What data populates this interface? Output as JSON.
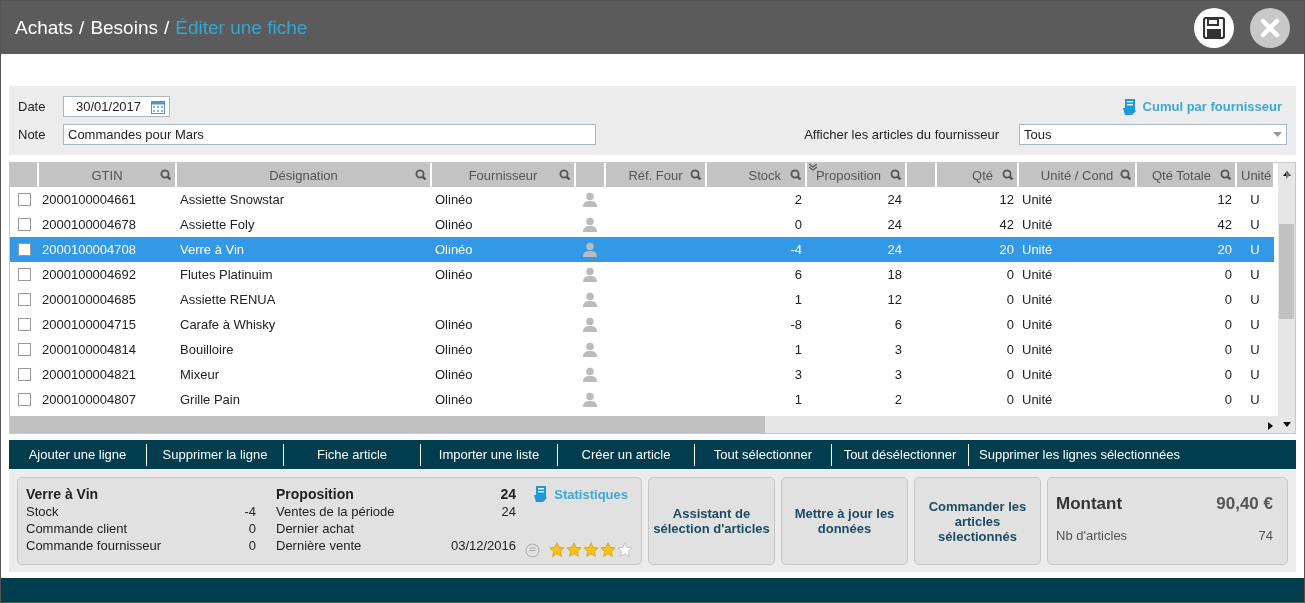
{
  "header": {
    "breadcrumb": [
      "Achats",
      "Besoins"
    ],
    "separator": "/",
    "current": "Éditer une fiche"
  },
  "form": {
    "date_label": "Date",
    "date": "30/01/2017",
    "note_label": "Note",
    "note": "Commandes pour Mars",
    "cumul_link": "Cumul par fournisseur",
    "supplier_filter_label": "Afficher les articles du fournisseur",
    "supplier_filter": "Tous"
  },
  "table": {
    "columns": [
      {
        "kind": "check"
      },
      {
        "kind": "text",
        "label": "GTIN",
        "search": true
      },
      {
        "kind": "text",
        "label": "Désignation",
        "search": true
      },
      {
        "kind": "text",
        "label": "Fournisseur",
        "search": true
      },
      {
        "kind": "icon"
      },
      {
        "kind": "text",
        "label": "Réf. Four",
        "search": true
      },
      {
        "kind": "num",
        "label": "Stock",
        "search": true
      },
      {
        "kind": "num",
        "label": "Proposition",
        "search": true,
        "sorted": true
      },
      {
        "kind": "blank"
      },
      {
        "kind": "num",
        "label": "Qté",
        "search": true
      },
      {
        "kind": "text",
        "label": "Unité / Cond",
        "search": true
      },
      {
        "kind": "num",
        "label": "Qté Totale",
        "search": true
      },
      {
        "kind": "center",
        "label": "Unité"
      }
    ],
    "rows": [
      {
        "selected": false,
        "checked": false,
        "cells": [
          "",
          "2000100004661",
          "Assiette Snowstar",
          "Olinéo",
          "",
          "",
          "2",
          "24",
          "",
          "12",
          "Unité",
          "12",
          "U"
        ]
      },
      {
        "selected": false,
        "checked": false,
        "cells": [
          "",
          "2000100004678",
          "Assiette Foly",
          "Olinéo",
          "",
          "",
          "0",
          "24",
          "",
          "42",
          "Unité",
          "42",
          "U"
        ]
      },
      {
        "selected": true,
        "checked": false,
        "cells": [
          "",
          "2000100004708",
          "Verre à Vin",
          "Olinéo",
          "",
          "",
          "-4",
          "24",
          "",
          "20",
          "Unité",
          "20",
          "U"
        ]
      },
      {
        "selected": false,
        "checked": false,
        "cells": [
          "",
          "2000100004692",
          "Flutes Platinuim",
          "Olinéo",
          "",
          "",
          "6",
          "18",
          "",
          "0",
          "Unité",
          "0",
          "U"
        ]
      },
      {
        "selected": false,
        "checked": false,
        "cells": [
          "",
          "2000100004685",
          "Assiette RENUA",
          "",
          "",
          "",
          "1",
          "12",
          "",
          "0",
          "Unité",
          "0",
          "U"
        ]
      },
      {
        "selected": false,
        "checked": false,
        "cells": [
          "",
          "2000100004715",
          "Carafe à Whisky",
          "Olinéo",
          "",
          "",
          "-8",
          "6",
          "",
          "0",
          "Unité",
          "0",
          "U"
        ]
      },
      {
        "selected": false,
        "checked": false,
        "cells": [
          "",
          "2000100004814",
          "Bouilloire",
          "Olinéo",
          "",
          "",
          "1",
          "3",
          "",
          "0",
          "Unité",
          "0",
          "U"
        ]
      },
      {
        "selected": false,
        "checked": false,
        "cells": [
          "",
          "2000100004821",
          "Mixeur",
          "Olinéo",
          "",
          "",
          "3",
          "3",
          "",
          "0",
          "Unité",
          "0",
          "U"
        ]
      },
      {
        "selected": false,
        "checked": false,
        "cells": [
          "",
          "2000100004807",
          "Grille Pain",
          "Olinéo",
          "",
          "",
          "1",
          "2",
          "",
          "0",
          "Unité",
          "0",
          "U"
        ]
      }
    ]
  },
  "toolbar": [
    "Ajouter une ligne",
    "Supprimer la ligne",
    "Fiche article",
    "Importer une liste",
    "Créer un article",
    "Tout sélectionner",
    "Tout désélectionner",
    "Supprimer les lignes sélectionnées"
  ],
  "details": {
    "title": "Verre à Vin",
    "left": [
      {
        "label": "Stock",
        "value": "-4"
      },
      {
        "label": "Commande client",
        "value": "0"
      },
      {
        "label": "Commande fournisseur",
        "value": "0"
      }
    ],
    "proposition_label": "Proposition",
    "proposition": "24",
    "right": [
      {
        "label": "Ventes de la période",
        "value": "24"
      },
      {
        "label": "Dernier achat"
      },
      {
        "label": "Dernière vente",
        "value": "03/12/2016"
      }
    ],
    "stats_link": "Statistiques",
    "stars": 4
  },
  "actions": [
    "Assistant de sélection d'articles",
    "Mettre à jour les données",
    "Commander les articles sélectionnés"
  ],
  "totals": {
    "amount_label": "Montant",
    "amount": "90,40 €",
    "count_label": "Nb d'articles",
    "count": "74"
  }
}
